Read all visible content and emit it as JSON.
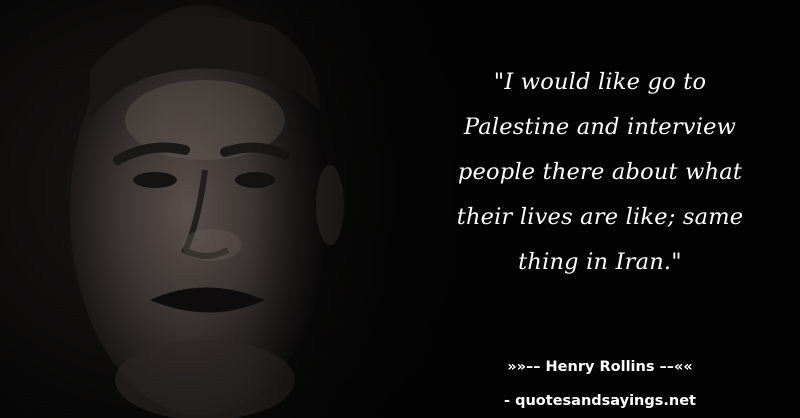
{
  "quote": {
    "text": "\"I would like go to\nPalestine and interview\npeople there about what\ntheir lives are like; same\nthing in Iran.\""
  },
  "attribution": {
    "prefix": "»»–– ",
    "author": "Henry Rollins",
    "suffix": " ––««"
  },
  "source": {
    "text": "- quotesandsayings.net"
  },
  "colors": {
    "background": "#030303",
    "text": "#ffffff"
  }
}
